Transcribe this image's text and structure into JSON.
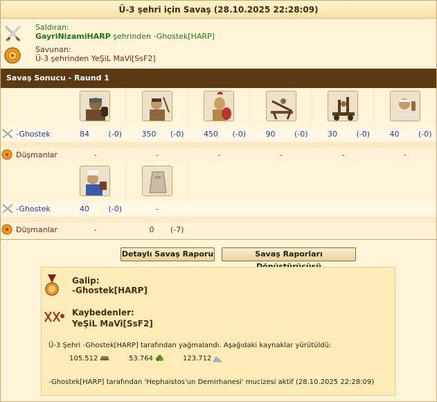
{
  "header": {
    "title": "Ü-3 şehri için Savaş (28.10.2025 22:28:09)"
  },
  "attacker": {
    "label": "Saldıran:",
    "player": "GayriNizamiHARP",
    "text": "şehrinden -Ghostek[HARP]",
    "icon": "crossed-swords-icon"
  },
  "defender": {
    "label": "Savunan:",
    "text": "Ü-3 şehrinden YeŞiL MaVi[SsF2]",
    "icon": "shield-icon"
  },
  "section": {
    "title": "Savaş Sonucu - Raund 1"
  },
  "rows": {
    "attacker_label": "-Ghostek",
    "defender_label": "Düşmanlar"
  },
  "block1": {
    "units": [
      "hoplite-icon",
      "slinger-icon",
      "phalanx-icon",
      "ballista-icon",
      "catapult-icon",
      "doctor-icon"
    ],
    "attacker": [
      {
        "n": "84",
        "d": "(-0)"
      },
      {
        "n": "350",
        "d": "(-0)"
      },
      {
        "n": "450",
        "d": "(-0)"
      },
      {
        "n": "90",
        "d": "(-0)"
      },
      {
        "n": "30",
        "d": "(-0)"
      },
      {
        "n": "40",
        "d": "(-0)"
      }
    ],
    "defender": [
      "-",
      "-",
      "-",
      "-",
      "-",
      "-"
    ]
  },
  "block2": {
    "units": [
      "cook-icon",
      "wall-icon"
    ],
    "attacker": [
      {
        "n": "40",
        "d": "(-0)"
      },
      {
        "n": "-",
        "d": ""
      }
    ],
    "defender": [
      {
        "n": "-",
        "d": ""
      },
      {
        "n": "0",
        "d": "(-7)"
      }
    ]
  },
  "buttons": {
    "detail": "Detaylı Savaş Raporu",
    "converter": "Savaş Raporları Dönüştürücüsü"
  },
  "result": {
    "winner_title": "Galip:",
    "winner_name": "-Ghostek[HARP]",
    "losers_title": "Kaybedenler:",
    "losers_name": "YeŞiL MaVi[SsF2]",
    "loot_text": "Ü-3 Şehri -Ghostek[HARP] tarafından yağmalandı. Aşağıdaki kaynaklar yürütüldü:",
    "resources": [
      {
        "value": "105.512",
        "icon": "wood-icon"
      },
      {
        "value": "53.764",
        "icon": "wine-icon"
      },
      {
        "value": "123.712",
        "icon": "marble-icon"
      }
    ],
    "miracle_text": "-Ghostek[HARP] tarafından 'Hephaistos'un Demirhanesi' mucizesi aktif (28.10.2025 22:28:09)"
  }
}
